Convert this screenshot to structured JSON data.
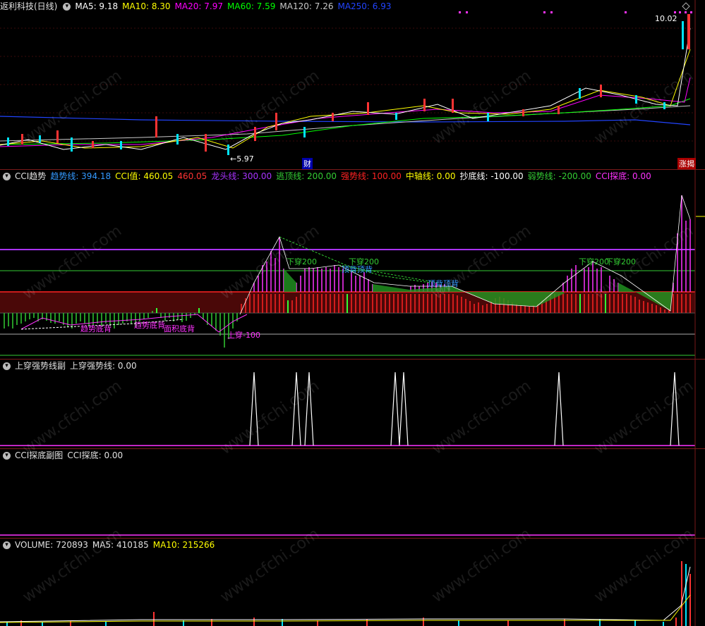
{
  "price_panel": {
    "title": "返利科技(日线)",
    "ma5": "MA5: 9.18",
    "ma10": "MA10: 8.30",
    "ma20": "MA20: 7.97",
    "ma60": "MA60: 7.59",
    "ma120": "MA120: 7.26",
    "ma250": "MA250: 6.93",
    "high_label": "10.02",
    "low_label": "5.97",
    "marker_cai": "财",
    "marker_zhangting": "涨揭"
  },
  "cci_panel": {
    "title": "CCI趋势",
    "trend": "趋势线: 394.18",
    "cci": "CCI值: 460.05",
    "cci2": "460.05",
    "dragon": "龙头线: 300.00",
    "escape": "逃顶线: 200.00",
    "strong": "强势线: 100.00",
    "axis": "中轴线: 0.00",
    "bottom": "抄底线: -100.00",
    "weak": "弱势线: -200.00",
    "probe": "CCI探底: 0.00",
    "annotations": [
      "下穿200",
      "下穿200",
      "顶背顶背",
      "顶背顶背",
      "下穿200",
      "下穿200",
      "趋势底背",
      "趋势底背",
      "面积底背",
      "上穿-100"
    ]
  },
  "strong_panel": {
    "title": "上穿强势线副",
    "value": "上穿强势线: 0.00"
  },
  "probe_panel": {
    "title": "CCI探底副图",
    "value": "CCI探底: 0.00"
  },
  "volume_panel": {
    "volume": "VOLUME: 720893",
    "ma5": "MA5: 410185",
    "ma10": "MA10: 215266"
  },
  "colors": {
    "ma5": "#ffffff",
    "ma10": "#ffff00",
    "ma20": "#ff00ff",
    "ma60": "#00ff00",
    "ma120": "#c8c8c8",
    "ma250": "#2244ff",
    "dragon": "#aa33ff",
    "strong": "#ff2222",
    "escape": "#33cc33"
  },
  "watermark": "www.cfchi.com"
}
